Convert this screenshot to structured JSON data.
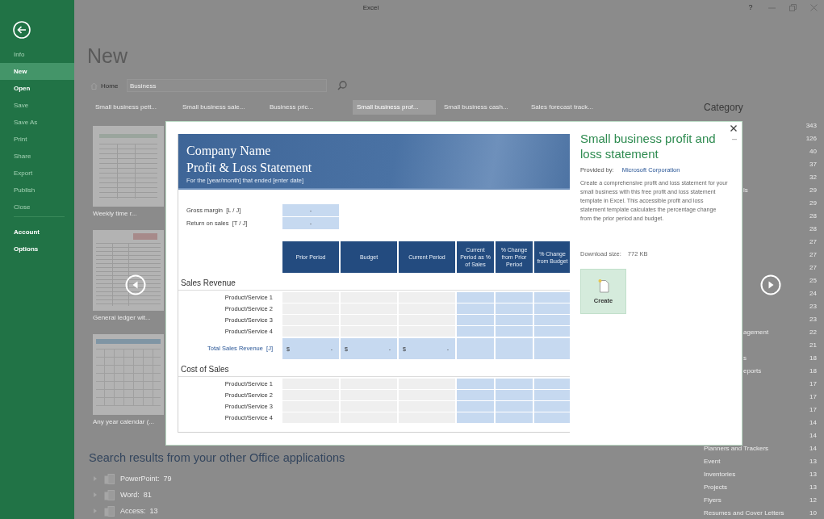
{
  "window": {
    "title": "Excel",
    "help": "?"
  },
  "sidebar": {
    "items": [
      {
        "label": "Info",
        "disabled": true,
        "selected": false
      },
      {
        "label": "New",
        "disabled": false,
        "selected": true
      },
      {
        "label": "Open",
        "disabled": false,
        "selected": false
      },
      {
        "label": "Save",
        "disabled": true,
        "selected": false
      },
      {
        "label": "Save As",
        "disabled": true,
        "selected": false
      },
      {
        "label": "Print",
        "disabled": true,
        "selected": false
      },
      {
        "label": "Share",
        "disabled": true,
        "selected": false
      },
      {
        "label": "Export",
        "disabled": true,
        "selected": false
      },
      {
        "label": "Publish",
        "disabled": true,
        "selected": false
      },
      {
        "label": "Close",
        "disabled": true,
        "selected": false
      }
    ],
    "footer_items": [
      {
        "label": "Account",
        "disabled": false,
        "selected": false
      },
      {
        "label": "Options",
        "disabled": false,
        "selected": false
      }
    ]
  },
  "page": {
    "heading": "New",
    "home_label": "Home",
    "search": {
      "value": "Business"
    }
  },
  "templates": {
    "names": [
      {
        "label": "Small business pett...",
        "selected": false
      },
      {
        "label": "Small business sale...",
        "selected": false
      },
      {
        "label": "Business pric...",
        "selected": false
      },
      {
        "label": "Small business prof...",
        "selected": true
      },
      {
        "label": "Small business cash...",
        "selected": false
      },
      {
        "label": "Sales forecast track...",
        "selected": false
      }
    ],
    "thumbnails": [
      {
        "label": "Weekly time r...",
        "kind": "timesheet"
      },
      {
        "label": "General ledger wit...",
        "kind": "ledger"
      },
      {
        "label": "Any year calendar (...",
        "kind": "calendar"
      }
    ]
  },
  "other_apps": {
    "heading": "Search results from your other Office applications",
    "items": [
      {
        "app": "PowerPoint:",
        "count": "79"
      },
      {
        "app": "Word:",
        "count": "81"
      },
      {
        "app": "Access:",
        "count": "13"
      }
    ]
  },
  "categories": {
    "heading": "Category",
    "rows": [
      {
        "count": "343"
      },
      {
        "count": "126"
      },
      {
        "count": "40"
      },
      {
        "count": "37"
      },
      {
        "count": "32"
      },
      {
        "name": "ls",
        "cut_by_dialog": true,
        "count": "29"
      },
      {
        "count": "29"
      },
      {
        "count": "28"
      },
      {
        "count": "28"
      },
      {
        "count": "27"
      },
      {
        "count": "27"
      },
      {
        "count": "27"
      },
      {
        "count": "25"
      },
      {
        "count": "24"
      },
      {
        "count": "23"
      },
      {
        "count": "23"
      },
      {
        "name": "agement",
        "cut_by_dialog": true,
        "count": "22"
      },
      {
        "count": "21"
      },
      {
        "name": "s",
        "cut_by_dialog": true,
        "count": "18"
      },
      {
        "name": "eports",
        "cut_by_dialog": true,
        "count": "18"
      },
      {
        "count": "17"
      },
      {
        "count": "17"
      },
      {
        "count": "17"
      },
      {
        "count": "14"
      },
      {
        "count": "14"
      },
      {
        "name": "Planners and Trackers",
        "cut_by_dialog": false,
        "count": "14"
      },
      {
        "name": "Event",
        "cut_by_dialog": false,
        "count": "13"
      },
      {
        "name": "Inventories",
        "cut_by_dialog": false,
        "count": "13"
      },
      {
        "name": "Projects",
        "cut_by_dialog": false,
        "count": "13"
      },
      {
        "name": "Flyers",
        "cut_by_dialog": false,
        "count": "12"
      },
      {
        "name": "Resumes and Cover Letters",
        "cut_by_dialog": false,
        "count": "10"
      }
    ]
  },
  "dialog": {
    "title": "Small business profit and loss statement",
    "provided_by_label": "Provided by:",
    "provider": "Microsoft Corporation",
    "description": "Create a comprehensive profit and loss statement for your small business with this free profit and loss statement template in Excel. This accessible profit and loss statement template calculates the percentage change from the prior period and budget.",
    "download_label": "Download size:",
    "download_size": "772 KB",
    "create_label": "Create",
    "preview": {
      "company": "Company Name",
      "statement": "Profit & Loss Statement",
      "period": "For the [year/month] that ended [enter date]",
      "ratios": [
        {
          "label": "Gross margin  [L / J]",
          "value": "-"
        },
        {
          "label": "Return on sales  [T / J]",
          "value": "-"
        }
      ],
      "columns": [
        "Prior Period",
        "Budget",
        "Current Period",
        "Current Period as % of Sales",
        "% Change from Prior Period",
        "% Change from Budget"
      ],
      "sections": [
        {
          "title": "Sales Revenue",
          "rows": [
            "Product/Service 1",
            "Product/Service 2",
            "Product/Service 3",
            "Product/Service 4"
          ],
          "total": {
            "label": "Total Sales Revenue  [J]",
            "cells": [
              {
                "currency": "$",
                "amount": "-"
              },
              {
                "currency": "$",
                "amount": "-"
              },
              {
                "currency": "$",
                "amount": "-"
              }
            ]
          }
        },
        {
          "title": "Cost of Sales",
          "rows": [
            "Product/Service 1",
            "Product/Service 2",
            "Product/Service 3",
            "Product/Service 4"
          ]
        }
      ]
    }
  }
}
